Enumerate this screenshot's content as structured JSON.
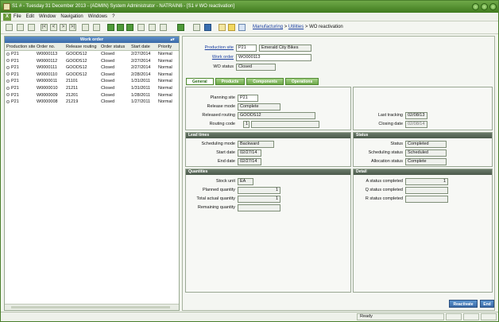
{
  "window": {
    "title": "S1 # - Tuesday 31 December 2013 - (ADMIN) System Administrator - NATRAIN6 - [S1 # WO reactivation]"
  },
  "menu": [
    "File",
    "Edit",
    "Window",
    "Navigation",
    "Windows",
    "?"
  ],
  "breadcrumb": {
    "part1": "Manufacturing",
    "sep1": " > ",
    "part2": "Utilities",
    "sep2": " > ",
    "part3": "WO reactivation"
  },
  "left_pane": {
    "title": "Work order",
    "columns": [
      "Production site",
      "Order no.",
      "Release routing",
      "Order status",
      "Start date",
      "Priority"
    ],
    "rows": [
      [
        "P21",
        "W0000113",
        "GOODS12",
        "Closed",
        "2/27/2014",
        "Normal"
      ],
      [
        "P21",
        "W0000112",
        "GOODS12",
        "Closed",
        "2/27/2014",
        "Normal"
      ],
      [
        "P21",
        "W0000111",
        "GOODS12",
        "Closed",
        "2/27/2014",
        "Normal"
      ],
      [
        "P21",
        "W0000110",
        "GOODS12",
        "Closed",
        "2/28/2014",
        "Normal"
      ],
      [
        "P21",
        "W0000011",
        "21101",
        "Closed",
        "1/31/2011",
        "Normal"
      ],
      [
        "P21",
        "W0000010",
        "21211",
        "Closed",
        "1/31/2011",
        "Normal"
      ],
      [
        "P21",
        "W0000009",
        "21201",
        "Closed",
        "1/28/2011",
        "Normal"
      ],
      [
        "P21",
        "W0000008",
        "21219",
        "Closed",
        "1/27/2011",
        "Normal"
      ]
    ]
  },
  "header": {
    "production_site_label": "Production site",
    "production_site": "P21",
    "production_site_name": "Emerald City Bikes",
    "work_order_label": "Work order",
    "work_order": "WO000113",
    "wo_status_label": "WO status",
    "wo_status": "Closed"
  },
  "tabs": [
    "General",
    "Products",
    "Components",
    "Operations"
  ],
  "general": {
    "planning_site_label": "Planning site",
    "planning_site": "P21",
    "release_mode_label": "Release mode",
    "release_mode": "Complete",
    "released_routing_label": "Released routing",
    "released_routing": "GOODS12",
    "routing_code_label": "Routing code",
    "routing_code": "1",
    "last_tracking_label": "Last tracking",
    "last_tracking": "02/08/13",
    "closing_date_label": "Closing date",
    "closing_date": "02/08/14"
  },
  "lead_times": {
    "title": "Lead times",
    "scheduling_mode_label": "Scheduling mode",
    "scheduling_mode": "Backward",
    "start_date_label": "Start date",
    "start_date": "02/27/14",
    "end_date_label": "End date",
    "end_date": "02/27/14"
  },
  "status": {
    "title": "Status",
    "status_label": "Status",
    "status": "Completed",
    "scheduling_status_label": "Scheduling status",
    "scheduling_status": "Scheduled",
    "allocation_status_label": "Allocation status",
    "allocation_status": "Complete"
  },
  "quantities": {
    "title": "Quantities",
    "stock_unit_label": "Stock unit",
    "stock_unit": "EA",
    "planned_quantity_label": "Planned quantity",
    "planned_quantity": "1",
    "total_actual_quantity_label": "Total actual quantity",
    "total_actual_quantity": "1",
    "remaining_quantity_label": "Remaining quantity",
    "remaining_quantity": ""
  },
  "detail": {
    "title": "Detail",
    "a_status_label": "A status completed",
    "a_status": "1",
    "q_status_label": "Q status completed",
    "q_status": "",
    "r_status_label": "R status completed",
    "r_status": ""
  },
  "actions": {
    "reactivate": "Reactivate",
    "end": "End"
  },
  "statusbar": {
    "text": "Ready"
  }
}
